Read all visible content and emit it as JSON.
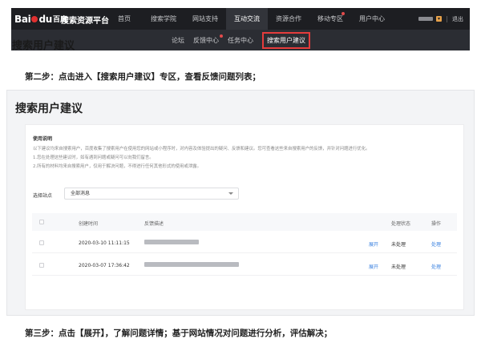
{
  "top": {
    "logo_text": "Bai",
    "logo_text2": "du",
    "logo_suffix": "百度",
    "site_title": "搜索资源平台",
    "nav": [
      {
        "label": "首页",
        "active": false,
        "dot": false
      },
      {
        "label": "搜索学院",
        "active": false,
        "dot": false
      },
      {
        "label": "网站支持",
        "active": false,
        "dot": false
      },
      {
        "label": "互动交流",
        "active": true,
        "dot": false
      },
      {
        "label": "资源合作",
        "active": false,
        "dot": false
      },
      {
        "label": "移动专区",
        "active": false,
        "dot": true
      },
      {
        "label": "用户中心",
        "active": false,
        "dot": false
      }
    ],
    "logout": "退出",
    "subnav": {
      "forum": "论坛",
      "feedback": "反馈中心",
      "tasks": "任务中心",
      "suggestions": "搜索用户建议"
    },
    "overlap_title": "搜索用户建议"
  },
  "step2": "第二步：点击进入【搜索用户建议】专区，查看反馈问题列表；",
  "step3": "第三步：点击【展开】，了解问题详情；基于网站情况对问题进行分析，评估解决；",
  "panel": {
    "title": "搜索用户建议",
    "notes_title": "使用说明",
    "notes": [
      "以下建议均来自搜索用户，百度收集了搜索用户在使用您的网站或小程序时，对内容及体验提出的疑问、反馈和建议。您可查看这些来自搜索用户的反馈，并针对问题进行优化。",
      "1.您在处理这些建议时，如有遇到问题或疑问可以向我们留言。",
      "2.所有的材料均来自搜索用户，仅用于解决问题，不得进行任何其他形式的使用或泄露。"
    ],
    "filter_label": "选择站点",
    "filter_value": "全部消息",
    "columns": {
      "time": "创建时间",
      "desc": "反馈描述",
      "status": "处理状态",
      "action": "操作"
    },
    "rows": [
      {
        "time": "2020-03-10 11:11:15",
        "expand": "展开",
        "status": "未处理",
        "action": "处理"
      },
      {
        "time": "2020-03-07 17:36:42",
        "expand": "展开",
        "status": "未处理",
        "action": "处理"
      }
    ]
  }
}
